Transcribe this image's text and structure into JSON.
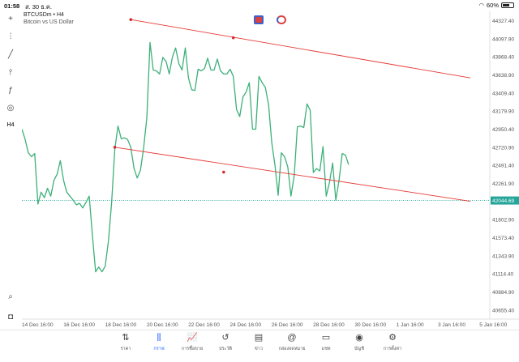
{
  "status": {
    "time": "01:58",
    "date": "ส. 30 ธ.ค.",
    "battery": "60%"
  },
  "symbol": {
    "name": "BTCUSDm • H4",
    "description": "Bitcoin vs US Dollar"
  },
  "toolbar": [
    {
      "name": "crosshair-icon",
      "glyph": "+"
    },
    {
      "name": "chart-type-icon",
      "glyph": "⫶"
    },
    {
      "name": "line-tools-icon",
      "glyph": "╱"
    },
    {
      "name": "indicators-icon",
      "glyph": "⫯"
    },
    {
      "name": "function-icon",
      "glyph": "ƒ"
    },
    {
      "name": "shapes-icon",
      "glyph": "◎"
    },
    {
      "name": "timeframe-label",
      "glyph": "H4"
    }
  ],
  "chart_data": {
    "type": "line",
    "series_color": "#3db07a",
    "y_ticks": [
      "44327.40",
      "44097.90",
      "43868.40",
      "43638.90",
      "43409.40",
      "43179.90",
      "42950.40",
      "42720.90",
      "42491.40",
      "42261.90",
      "42032.40",
      "41802.90",
      "41573.40",
      "41343.90",
      "41114.40",
      "40884.90",
      "40655.40"
    ],
    "y_range": [
      40540,
      44445
    ],
    "x_ticks": [
      "14 Dec 16:00",
      "16 Dec 16:00",
      "18 Dec 16:00",
      "20 Dec 16:00",
      "22 Dec 16:00",
      "24 Dec 16:00",
      "26 Dec 16:00",
      "28 Dec 16:00",
      "30 Dec 16:00",
      "1 Jan 16:00",
      "3 Jan 16:00",
      "5 Jan 16:00"
    ],
    "current_price": "42044.69",
    "current_value": 42044.69,
    "price_color": "#26a69a",
    "trendline_color": "#e53935",
    "trendlines": [
      {
        "start_bar": 34,
        "end_bar": 140,
        "start_value": 44340,
        "end_value": 43600,
        "anchor_bar": 66,
        "anchor_value": 44110
      },
      {
        "start_bar": 29,
        "end_bar": 140,
        "start_value": 42720,
        "end_value": 42035,
        "anchor_bar": 63,
        "anchor_value": 42405
      }
    ],
    "values": [
      42950,
      42820,
      42650,
      42600,
      42640,
      42000,
      42150,
      42080,
      42200,
      42100,
      42300,
      42380,
      42550,
      42300,
      42150,
      42100,
      42050,
      41990,
      42010,
      41950,
      42020,
      42100,
      41610,
      41140,
      41200,
      41140,
      41210,
      41530,
      42010,
      42700,
      42990,
      42830,
      42840,
      42820,
      42720,
      42450,
      42330,
      42430,
      42710,
      43100,
      44050,
      43700,
      43690,
      43650,
      43860,
      43810,
      43650,
      43870,
      43980,
      43780,
      43700,
      43980,
      43600,
      43450,
      43440,
      43710,
      43690,
      43720,
      43850,
      43700,
      43700,
      43840,
      43690,
      43650,
      43650,
      43710,
      43620,
      43200,
      43110,
      43360,
      43420,
      43540,
      42950,
      42950,
      43620,
      43540,
      43480,
      43260,
      42780,
      42490,
      42110,
      42650,
      42600,
      42470,
      42100,
      42360,
      42980,
      42990,
      42970,
      43270,
      43190,
      42400,
      42450,
      42420,
      42730,
      42100,
      42270,
      42520,
      42050,
      42300,
      42640,
      42620,
      42500
    ]
  },
  "nav": [
    {
      "name": "nav-quotes",
      "icon": "quotes-icon",
      "glyph": "⇅",
      "label": "ราคา"
    },
    {
      "name": "nav-chart",
      "icon": "chart-icon",
      "glyph": "⫼",
      "label": "กราฟ",
      "active": true
    },
    {
      "name": "nav-trade",
      "icon": "trade-icon",
      "glyph": "📈",
      "label": "การซื้อขาย"
    },
    {
      "name": "nav-history",
      "icon": "history-icon",
      "glyph": "↺",
      "label": "ประวัติ"
    },
    {
      "name": "nav-news",
      "icon": "news-icon",
      "glyph": "▤",
      "label": "ข่าว"
    },
    {
      "name": "nav-mailbox",
      "icon": "mail-icon",
      "glyph": "@",
      "label": "กล่องจดหมาย"
    },
    {
      "name": "nav-chat",
      "icon": "chat-icon",
      "glyph": "▭",
      "label": "แชท"
    },
    {
      "name": "nav-account",
      "icon": "account-icon",
      "glyph": "◉",
      "label": "บัญชี"
    },
    {
      "name": "nav-settings",
      "icon": "settings-icon",
      "glyph": "⚙",
      "label": "การตั้งค่า"
    }
  ]
}
